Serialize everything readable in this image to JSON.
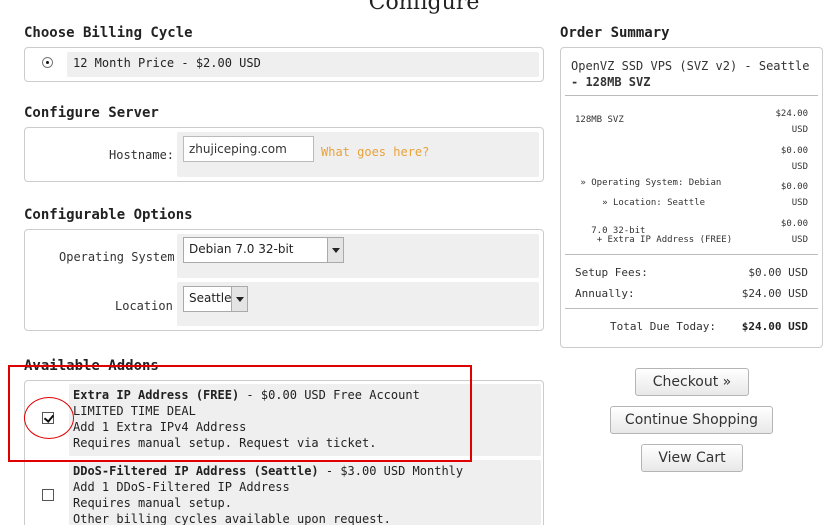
{
  "page": {
    "title": "Configure"
  },
  "billing": {
    "heading": "Choose Billing Cycle",
    "option": "12 Month Price - $2.00 USD"
  },
  "server": {
    "heading": "Configure Server",
    "hostname_label": "Hostname:",
    "hostname_value": "zhujiceping.com",
    "help": "What goes here?"
  },
  "options": {
    "heading": "Configurable Options",
    "os_label": "Operating System",
    "os_value": "Debian 7.0 32-bit",
    "location_label": "Location",
    "location_value": "Seattle"
  },
  "addons": {
    "heading": "Available Addons",
    "items": [
      {
        "name": "Extra IP Address (FREE)",
        "price": " - $0.00 USD Free Account",
        "lines": [
          "LIMITED TIME DEAL",
          "Add 1 Extra IPv4 Address",
          "Requires manual setup. Request via ticket."
        ],
        "checked": true
      },
      {
        "name": "DDoS-Filtered IP Address (Seattle)",
        "price": " - $3.00 USD Monthly",
        "lines": [
          "Add 1 DDoS-Filtered IP Address",
          "Requires manual setup.",
          "Other billing cycles available upon request."
        ],
        "checked": false
      }
    ]
  },
  "summary": {
    "heading": "Order Summary",
    "product_line1": "OpenVZ SSD VPS (SVZ v2) - Seattle",
    "product_line2": "- 128MB SVZ",
    "items": [
      {
        "label": "128MB SVZ",
        "label2": "",
        "amount": "$24.00",
        "unit": "USD"
      },
      {
        "label": " » Operating System: Debian",
        "label2": "   7.0 32-bit",
        "amount": "$0.00",
        "unit": "USD"
      },
      {
        "label": " » Location: Seattle",
        "label2": "",
        "amount": "$0.00",
        "unit": "USD"
      },
      {
        "label": "+ Extra IP Address (FREE)",
        "label2": "",
        "amount": "$0.00",
        "unit": "USD"
      }
    ],
    "setup_label": "Setup Fees:",
    "setup_value": "$0.00 USD",
    "annual_label": "Annually:",
    "annual_value": "$24.00 USD",
    "total_label": "Total Due Today:",
    "total_value": "$24.00 USD"
  },
  "buttons": {
    "checkout": "Checkout »",
    "continue": "Continue Shopping",
    "view_cart": "View Cart"
  },
  "colors": {
    "highlight": "#e00000",
    "help_link": "#e8a23a",
    "panel_bg": "#efefef"
  }
}
